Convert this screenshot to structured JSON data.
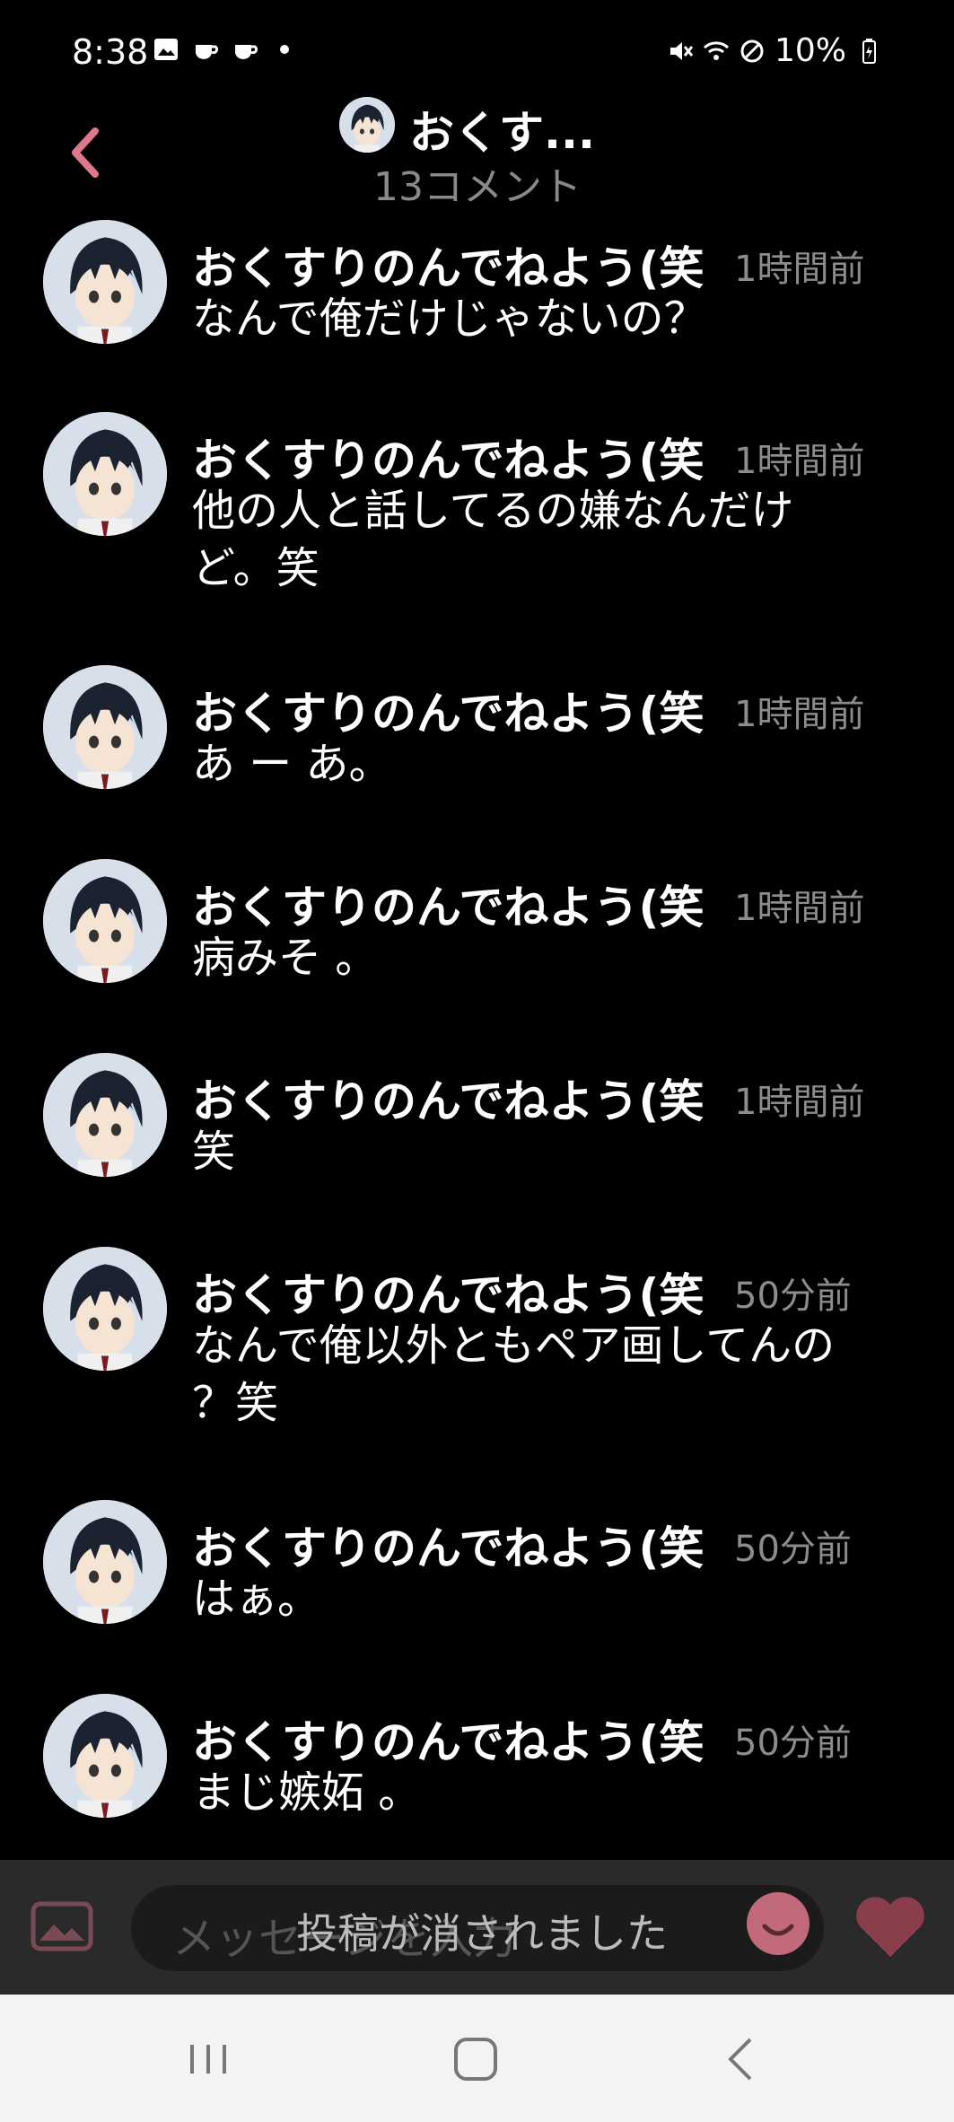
{
  "status_bar": {
    "time": "8:38",
    "battery": "10%"
  },
  "header": {
    "title": "おくす...",
    "subtitle": "13コメント"
  },
  "comments": [
    {
      "name": "おくすりのんでねよう(笑",
      "time": "1時間前",
      "text": "なんで俺だけじゃないの？"
    },
    {
      "name": "おくすりのんでねよう(笑",
      "time": "1時間前",
      "text": "他の人と話してるの嫌なんだけど。笑"
    },
    {
      "name": "おくすりのんでねよう(笑",
      "time": "1時間前",
      "text": "あ ー あ。"
    },
    {
      "name": "おくすりのんでねよう(笑",
      "time": "1時間前",
      "text": "病みそ 。"
    },
    {
      "name": "おくすりのんでねよう(笑",
      "time": "1時間前",
      "text": "笑"
    },
    {
      "name": "おくすりのんでねよう(笑",
      "time": "50分前",
      "text": "なんで俺以外ともペア画してんの ？笑"
    },
    {
      "name": "おくすりのんでねよう(笑",
      "time": "50分前",
      "text": "はぁ。"
    },
    {
      "name": "おくすりのんでねよう(笑",
      "time": "50分前",
      "text": "まじ嫉妬 。"
    }
  ],
  "input": {
    "placeholder": "メッセージを入力"
  },
  "toast": "投稿が消されました",
  "colors": {
    "accent": "#e0788c",
    "background": "#000000",
    "input_bar": "#2a2a2a"
  }
}
